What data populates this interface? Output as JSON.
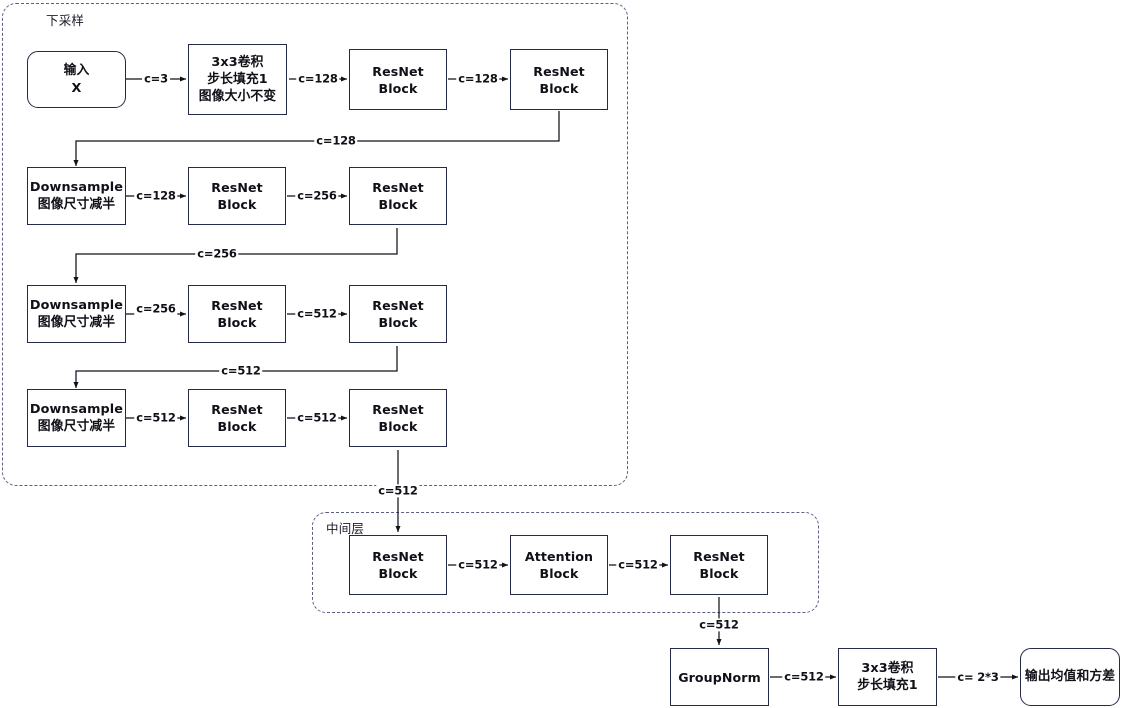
{
  "diagram": {
    "title_groups": [
      {
        "id": "downsample-group",
        "label": "下采样"
      },
      {
        "id": "middle-group",
        "label": "中间层"
      }
    ],
    "nodes": {
      "input": {
        "lines": [
          "输入",
          "X"
        ]
      },
      "conv_in": {
        "lines": [
          "3x3卷积",
          "步长填充1",
          "图像大小不变"
        ]
      },
      "r1a": {
        "lines": [
          "ResNet",
          "Block"
        ]
      },
      "r1b": {
        "lines": [
          "ResNet",
          "Block"
        ]
      },
      "down2": {
        "lines": [
          "Downsample",
          "图像尺寸减半"
        ]
      },
      "r2a": {
        "lines": [
          "ResNet",
          "Block"
        ]
      },
      "r2b": {
        "lines": [
          "ResNet",
          "Block"
        ]
      },
      "down3": {
        "lines": [
          "Downsample",
          "图像尺寸减半"
        ]
      },
      "r3a": {
        "lines": [
          "ResNet",
          "Block"
        ]
      },
      "r3b": {
        "lines": [
          "ResNet",
          "Block"
        ]
      },
      "down4": {
        "lines": [
          "Downsample",
          "图像尺寸减半"
        ]
      },
      "r4a": {
        "lines": [
          "ResNet",
          "Block"
        ]
      },
      "r4b": {
        "lines": [
          "ResNet",
          "Block"
        ]
      },
      "mid_r1": {
        "lines": [
          "ResNet",
          "Block"
        ]
      },
      "mid_attn": {
        "lines": [
          "Attention",
          "Block"
        ]
      },
      "mid_r2": {
        "lines": [
          "ResNet",
          "Block"
        ]
      },
      "groupnorm": {
        "lines": [
          "GroupNorm"
        ]
      },
      "conv_out": {
        "lines": [
          "3x3卷积",
          "步长填充1"
        ]
      },
      "output": {
        "lines": [
          "输出均值和方差"
        ]
      }
    },
    "edge_labels": {
      "e_in_conv": "c=3",
      "e_conv_r1a": "c=128",
      "e_r1a_r1b": "c=128",
      "e_row1_row2": "c=128",
      "e_down2_r2a": "c=128",
      "e_r2a_r2b": "c=256",
      "e_row2_row3": "c=256",
      "e_down3_r3a": "c=256",
      "e_r3a_r3b": "c=512",
      "e_row3_row4": "c=512",
      "e_down4_r4a": "c=512",
      "e_r4a_r4b": "c=512",
      "e_row4_mid": "c=512",
      "e_midr1_attn": "c=512",
      "e_attn_midr2": "c=512",
      "e_mid_gn": "c=512",
      "e_gn_conv": "c=512",
      "e_conv_out_l1": "c=",
      "e_conv_out_l2": "2*3"
    },
    "colors": {
      "node_stroke": "#25294a",
      "group_stroke": "#5a5f86",
      "wire": "#12121c",
      "text": "#101018",
      "background": "#ffffff"
    }
  }
}
